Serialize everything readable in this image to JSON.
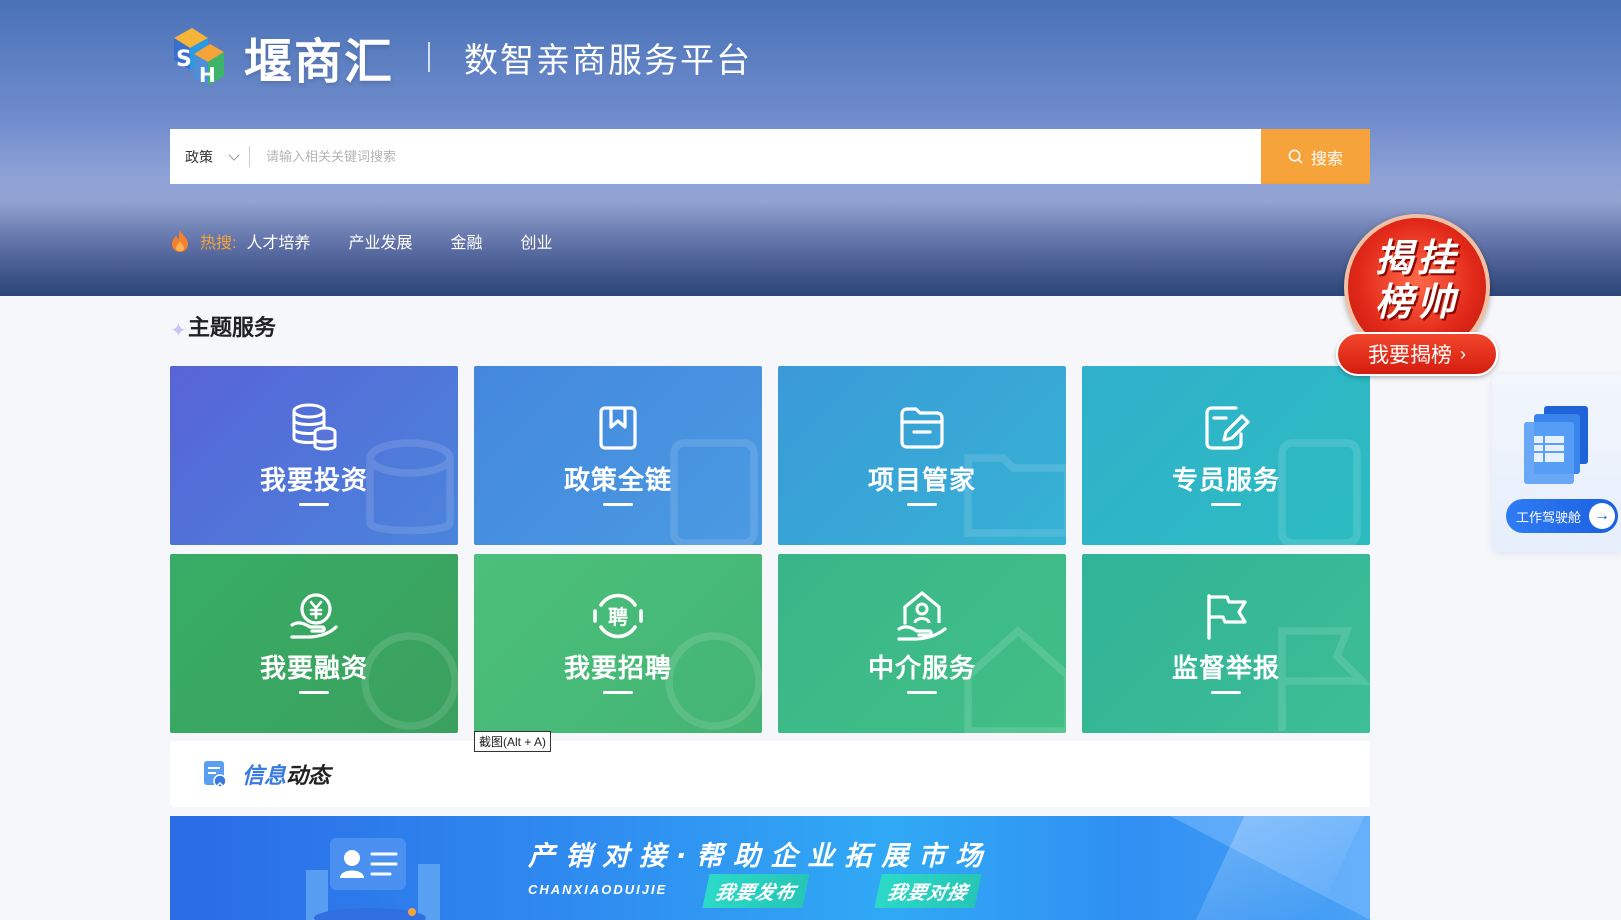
{
  "header": {
    "logo_name": "堰商汇",
    "slogan": "数智亲商服务平台"
  },
  "search": {
    "category": "政策",
    "placeholder": "请输入相关关键词搜索",
    "button_label": "搜索"
  },
  "hot_search": {
    "label": "热搜:",
    "items": [
      "人才培养",
      "产业发展",
      "金融",
      "创业"
    ]
  },
  "jiebang": {
    "badge_text_line1": "揭挂",
    "badge_text_line2": "榜帅",
    "button_label": "我要揭榜",
    "arrow": "›"
  },
  "cockpit": {
    "label": "工作驾驶舱",
    "arrow": "→"
  },
  "section": {
    "title": "主题服务"
  },
  "cards": [
    {
      "label": "我要投资",
      "icon": "database-icon",
      "color": "#5a6fd8"
    },
    {
      "label": "政策全链",
      "icon": "bookmark-icon",
      "color": "#4a8fe0"
    },
    {
      "label": "项目管家",
      "icon": "folder-icon",
      "color": "#3aa8d8"
    },
    {
      "label": "专员服务",
      "icon": "edit-document-icon",
      "color": "#2fb6c6"
    },
    {
      "label": "我要融资",
      "icon": "yuan-hand-icon",
      "color": "#3aa862"
    },
    {
      "label": "我要招聘",
      "icon": "recruit-icon",
      "color": "#4ec27a"
    },
    {
      "label": "中介服务",
      "icon": "house-service-icon",
      "color": "#3dba8a"
    },
    {
      "label": "监督举报",
      "icon": "flag-icon",
      "color": "#34b89a"
    }
  ],
  "tooltip": "截图(Alt + A)",
  "info": {
    "title_part1": "信息",
    "title_part2": "动态"
  },
  "banner": {
    "title": "产销对接·帮助企业拓展市场",
    "subtitle": "CHANXIAODUIJIE",
    "button1": "我要发布",
    "button2": "我要对接"
  },
  "colors": {
    "accent": "#f5a33a",
    "hot_label": "#f5a33a",
    "link_blue": "#3a7be0"
  }
}
